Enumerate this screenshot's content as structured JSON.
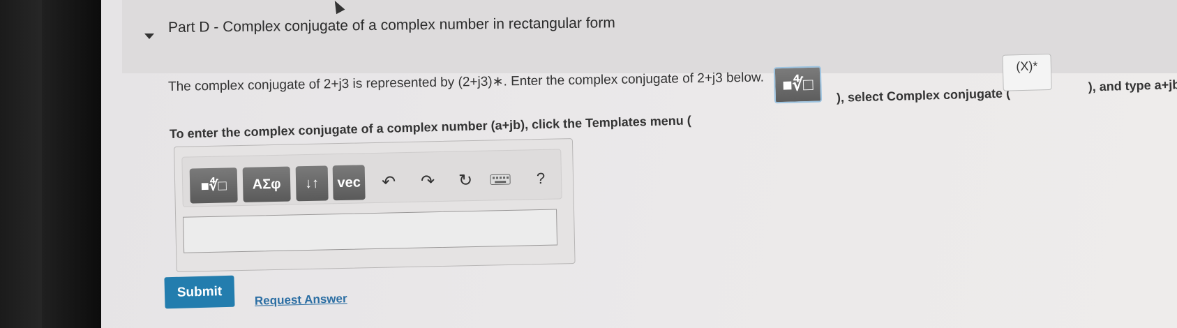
{
  "part": {
    "title": "Part D - Complex conjugate of a complex number in rectangular form"
  },
  "instructions": {
    "line1": "The complex conjugate of 2+j3 is represented by (2+j3)∗. Enter the complex conjugate of 2+j3 below.",
    "line2_start": "To enter the complex conjugate of a complex number (a+jb), click the Templates menu (",
    "line2_mid": "), select Complex conjugate (",
    "line2_end": "), and type a+jb.",
    "conjugate_template_label": "(X)*"
  },
  "toolbar": {
    "templates_icon": "■∜□",
    "symbols_label": "ΑΣφ",
    "arrows_label": "↓↑",
    "vec_label": "vec",
    "help_label": "?"
  },
  "answer_input": {
    "value": ""
  },
  "actions": {
    "submit_label": "Submit",
    "request_answer_label": "Request Answer"
  },
  "colors": {
    "submit": "#237dae",
    "link": "#2b6ea3",
    "toolbar_button": "#6a6a6a"
  }
}
